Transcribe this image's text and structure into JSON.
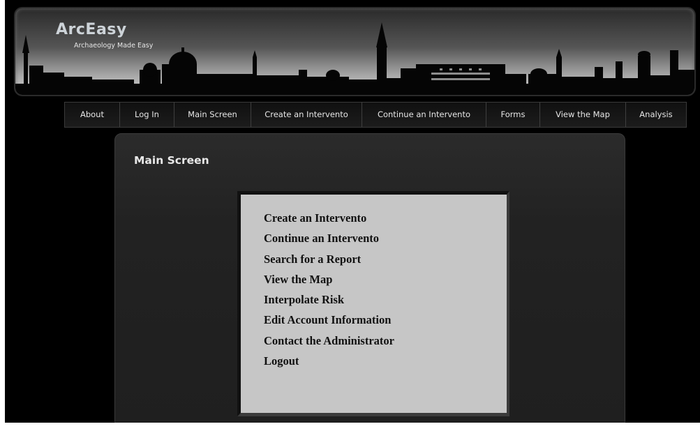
{
  "brand": {
    "title": "ArcEasy",
    "tagline": "Archaeology Made Easy"
  },
  "nav": [
    {
      "label": "About"
    },
    {
      "label": "Log In"
    },
    {
      "label": "Main Screen"
    },
    {
      "label": "Create an Intervento"
    },
    {
      "label": "Continue an Intervento"
    },
    {
      "label": "Forms"
    },
    {
      "label": "View the Map"
    },
    {
      "label": "Analysis"
    }
  ],
  "main": {
    "title": "Main Screen",
    "menu": [
      {
        "label": "Create an Intervento"
      },
      {
        "label": "Continue an Intervento"
      },
      {
        "label": "Search for a Report"
      },
      {
        "label": "View the Map"
      },
      {
        "label": "Interpolate Risk"
      },
      {
        "label": "Edit Account Information"
      },
      {
        "label": "Contact the Administrator"
      },
      {
        "label": "Logout"
      }
    ]
  }
}
